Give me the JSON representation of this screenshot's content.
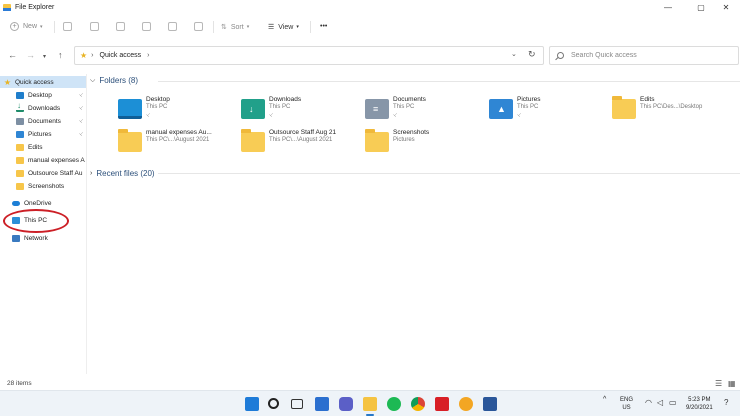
{
  "window": {
    "title": "File Explorer",
    "min": "—",
    "max": "▢",
    "close": "✕"
  },
  "toolbar": {
    "new_label": "New",
    "sort_label": "Sort",
    "view_label": "View",
    "more_label": "•••"
  },
  "address": {
    "crumb": "Quick access",
    "separator": "›"
  },
  "search": {
    "placeholder": "Search Quick access"
  },
  "sidebar": {
    "items": [
      {
        "label": "Quick access",
        "icon": "star-icon",
        "selected": true
      },
      {
        "label": "Desktop",
        "icon": "desktop-icon",
        "pinned": true
      },
      {
        "label": "Downloads",
        "icon": "downloads-icon",
        "pinned": true
      },
      {
        "label": "Documents",
        "icon": "documents-icon",
        "pinned": true
      },
      {
        "label": "Pictures",
        "icon": "pictures-icon",
        "pinned": true
      },
      {
        "label": "Edits",
        "icon": "folder-icon"
      },
      {
        "label": "manual expenses A",
        "icon": "folder-icon"
      },
      {
        "label": "Outsource Staff Au",
        "icon": "folder-icon"
      },
      {
        "label": "Screenshots",
        "icon": "folder-icon"
      },
      {
        "label": "OneDrive",
        "icon": "onedrive-icon"
      },
      {
        "label": "This PC",
        "icon": "this-pc-icon"
      },
      {
        "label": "Network",
        "icon": "network-icon"
      }
    ],
    "pin_glyph": "📌"
  },
  "main": {
    "folders_header": "Folders (8)",
    "recent_header": "Recent files (20)",
    "folders": [
      {
        "name": "Desktop",
        "location": "This PC",
        "pinned": true,
        "icon": "desktop-folder-icon"
      },
      {
        "name": "Downloads",
        "location": "This PC",
        "pinned": true,
        "icon": "downloads-folder-icon"
      },
      {
        "name": "Documents",
        "location": "This PC",
        "pinned": true,
        "icon": "documents-folder-icon"
      },
      {
        "name": "Pictures",
        "location": "This PC",
        "pinned": true,
        "icon": "pictures-folder-icon"
      },
      {
        "name": "Edits",
        "location": "This PC\\Des...\\Desktop",
        "pinned": false,
        "icon": "folder-icon"
      },
      {
        "name": "manual expenses Au...",
        "location": "This PC\\...\\August 2021",
        "pinned": false,
        "icon": "folder-icon"
      },
      {
        "name": "Outsource Staff Aug 21",
        "location": "This PC\\...\\August 2021",
        "pinned": false,
        "icon": "folder-icon"
      },
      {
        "name": "Screenshots",
        "location": "Pictures",
        "pinned": false,
        "icon": "folder-icon"
      }
    ]
  },
  "status": {
    "item_count": "28 items"
  },
  "taskbar": {
    "lang_line1": "ENG",
    "lang_line2": "US",
    "time": "5:23 PM",
    "date": "9/20/2021",
    "tray_chevron": "^"
  },
  "colors": {
    "accent": "#2878c8",
    "selection": "#cfe4f7",
    "folder": "#f8cc55",
    "annotation_circle": "#cc1f26"
  }
}
